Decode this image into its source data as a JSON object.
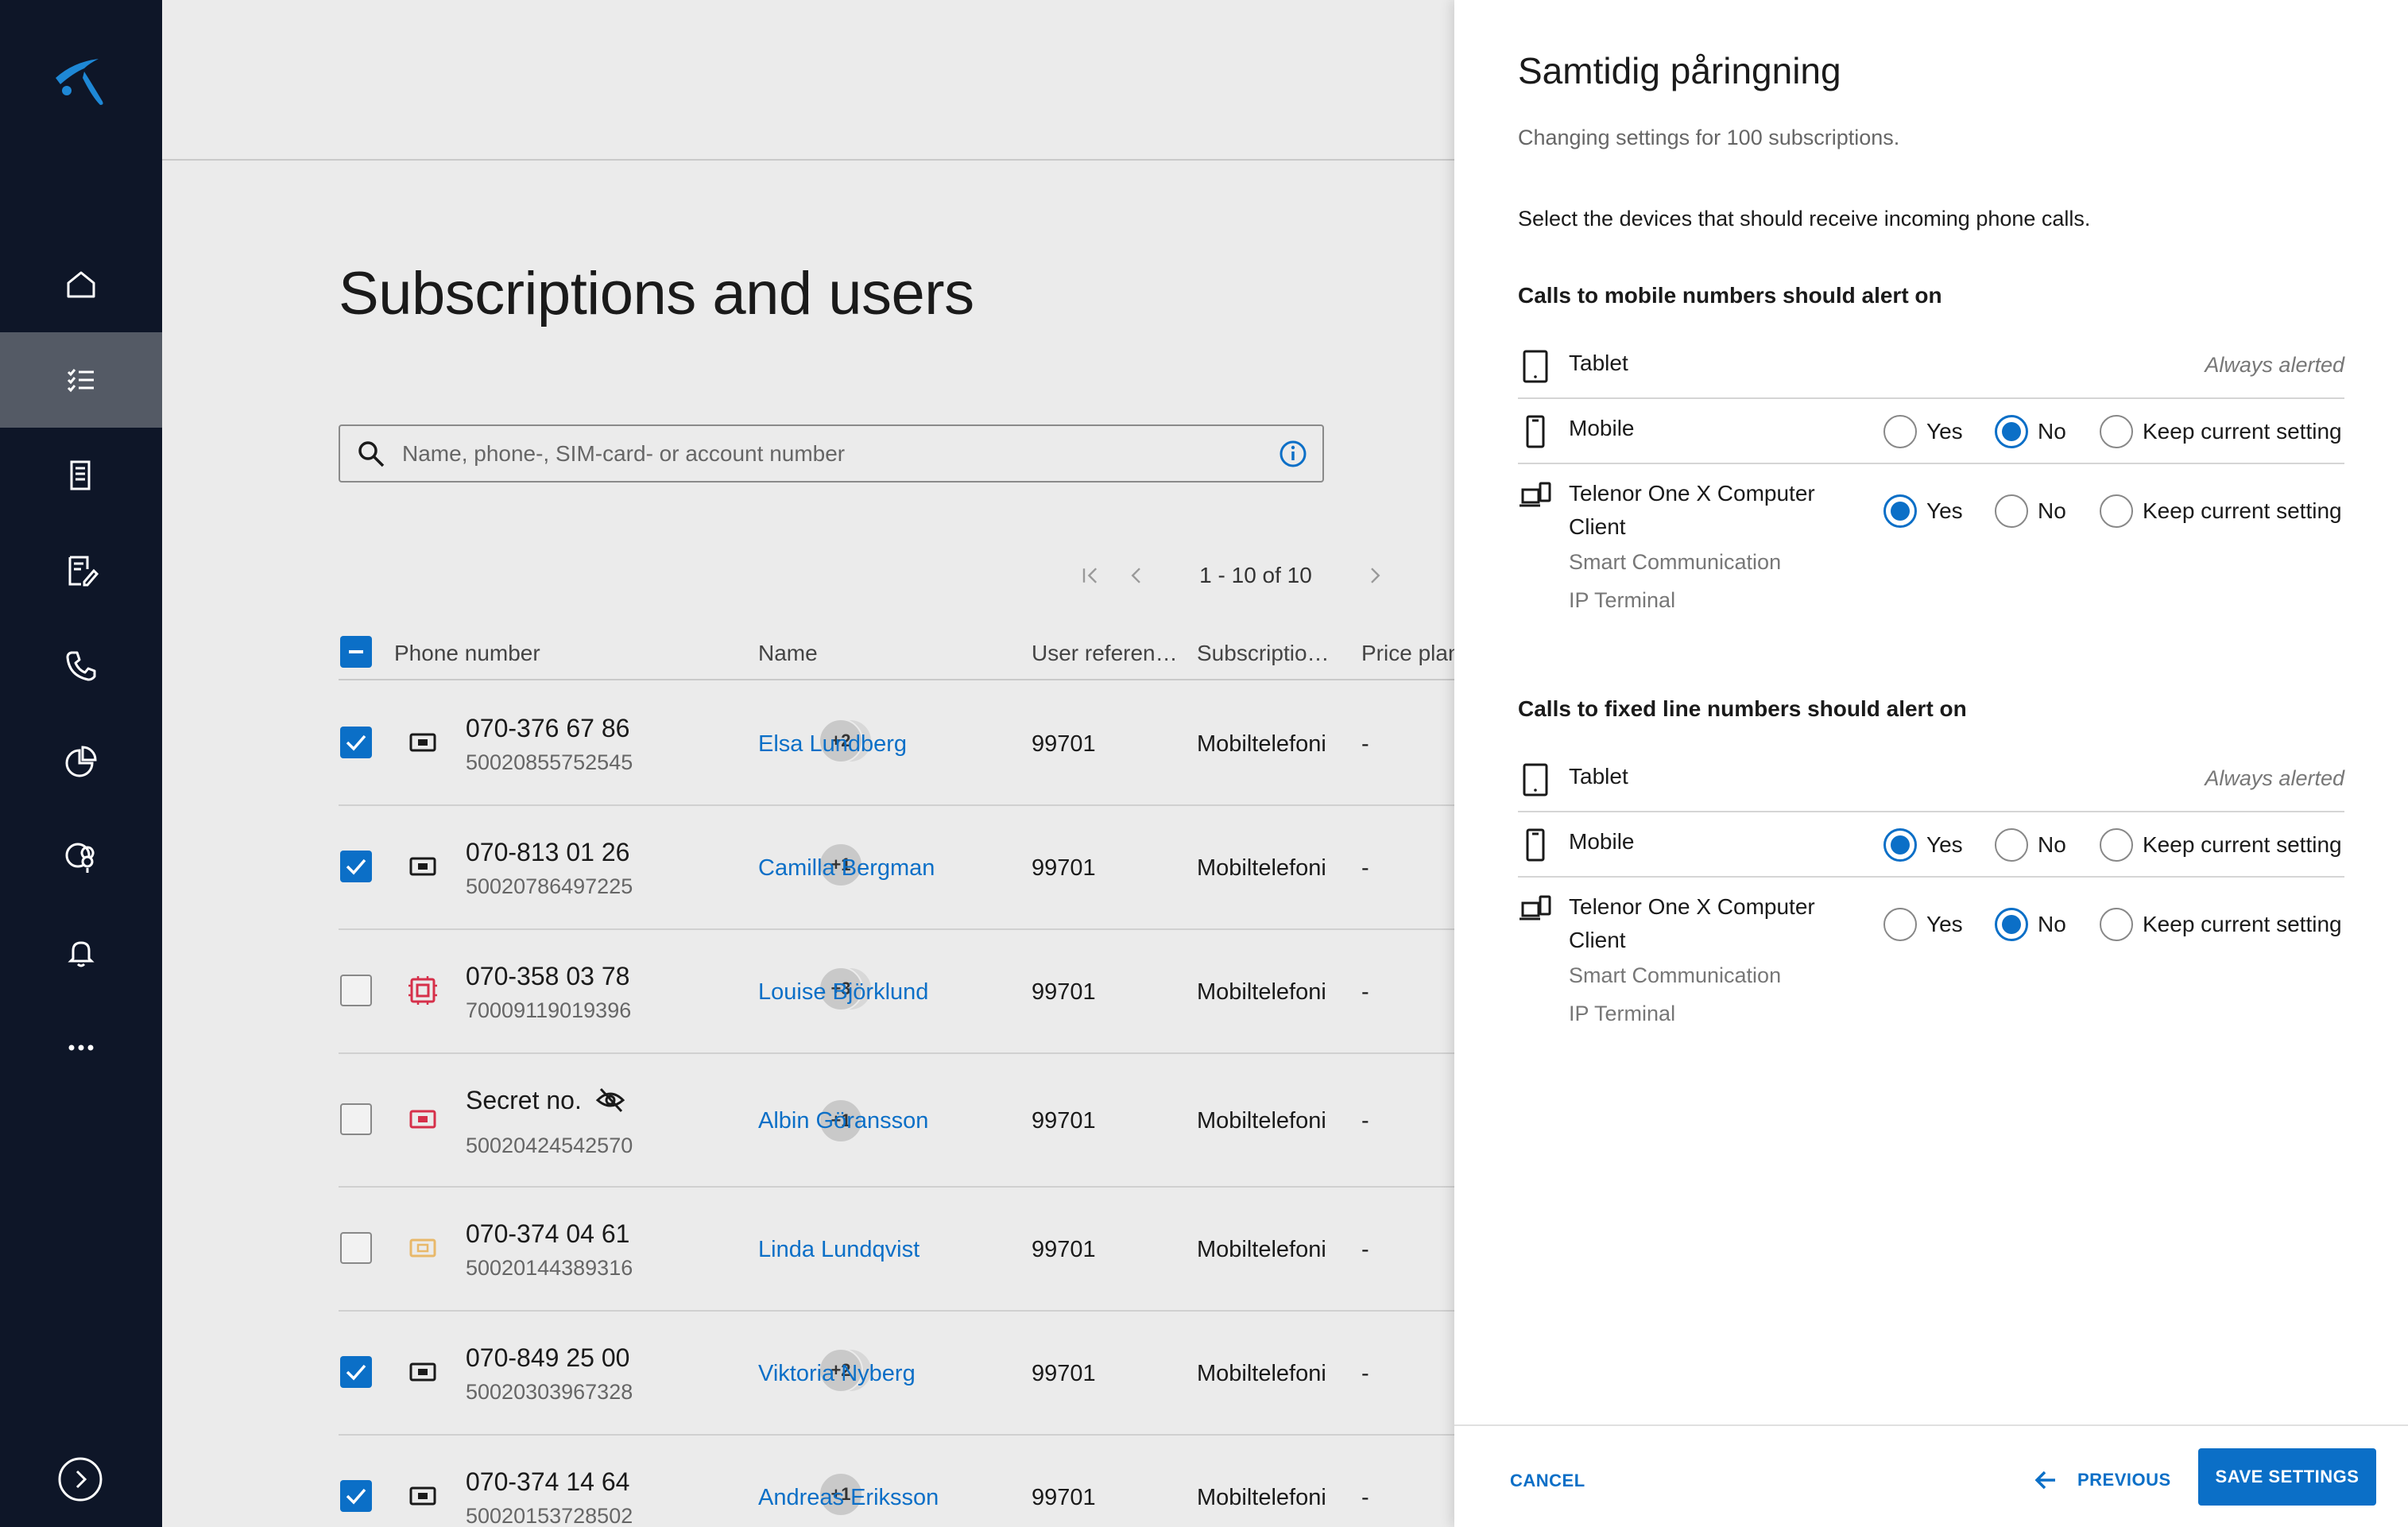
{
  "sidebar": {
    "items": [
      "home-icon",
      "subscriptions-icon",
      "invoice-icon",
      "orders-icon",
      "phone-icon",
      "reports-icon",
      "location-settings-icon",
      "notifications-icon",
      "more-icon"
    ],
    "active": "subscriptions-icon"
  },
  "main": {
    "title": "Subscriptions and users",
    "search_placeholder": "Name, phone-, SIM-card- or account number",
    "pager_text": "1 - 10 of 10",
    "columns": {
      "phone": "Phone number",
      "name": "Name",
      "userref": "User referen…",
      "subscription": "Subscriptio…",
      "priceplan": "Price plan"
    },
    "rows": [
      {
        "phone": "070-376 67 86",
        "sim": "50020855752545",
        "badge": "+2",
        "name": "Elsa Lundberg",
        "ref": "99701",
        "sub": "Mobiltelefoni",
        "plan": "-",
        "checked": true
      },
      {
        "phone": "070-813 01 26",
        "sim": "50020786497225",
        "badge": "+1",
        "name": "Camilla Bergman",
        "ref": "99701",
        "sub": "Mobiltelefoni",
        "plan": "-",
        "checked": true
      },
      {
        "phone": "070-358 03 78",
        "sim": "70009119019396",
        "badge": "+3",
        "name": "Louise Björklund",
        "ref": "99701",
        "sub": "Mobiltelefoni",
        "plan": "-",
        "checked": false
      },
      {
        "phone": "Secret no.",
        "sim": "50020424542570",
        "badge": "+1",
        "name": "Albin Göransson",
        "ref": "99701",
        "sub": "Mobiltelefoni",
        "plan": "-",
        "checked": false
      },
      {
        "phone": "070-374 04 61",
        "sim": "50020144389316",
        "badge": "",
        "name": "Linda Lundqvist",
        "ref": "99701",
        "sub": "Mobiltelefoni",
        "plan": "-",
        "checked": false
      },
      {
        "phone": "070-849 25 00",
        "sim": "50020303967328",
        "badge": "+2",
        "name": "Viktoria Nyberg",
        "ref": "99701",
        "sub": "Mobiltelefoni",
        "plan": "-",
        "checked": true
      },
      {
        "phone": "070-374 14 64",
        "sim": "50020153728502",
        "badge": "+1",
        "name": "Andreas Eriksson",
        "ref": "99701",
        "sub": "Mobiltelefoni",
        "plan": "-",
        "checked": true
      }
    ]
  },
  "panel": {
    "title": "Samtidig påringning",
    "subtitle": "Changing settings for 100 subscriptions.",
    "instruction": "Select the devices that should receive incoming phone calls.",
    "always_alerted": "Always alerted",
    "yes": "Yes",
    "no": "No",
    "keep": "Keep current setting",
    "sections": [
      {
        "heading": "Calls to mobile numbers should alert on",
        "tablet": "Tablet",
        "mobile": "Mobile",
        "mobile_choice": "No",
        "client": "Telenor One X Computer Client",
        "client_choice": "Yes",
        "client_sub1": "Smart Communication",
        "client_sub2": "IP Terminal"
      },
      {
        "heading": "Calls to fixed line numbers should alert on",
        "tablet": "Tablet",
        "mobile": "Mobile",
        "mobile_choice": "Yes",
        "client": "Telenor One X Computer Client",
        "client_choice": "No",
        "client_sub1": "Smart Communication",
        "client_sub2": "IP Terminal"
      }
    ],
    "footer": {
      "cancel": "CANCEL",
      "previous": "PREVIOUS",
      "save": "SAVE SETTINGS"
    }
  },
  "colors": {
    "accent": "#0b6fc7",
    "sidebar": "#0e1628",
    "sim_red": "#d6304a",
    "sim_gold": "#e8b86a"
  }
}
